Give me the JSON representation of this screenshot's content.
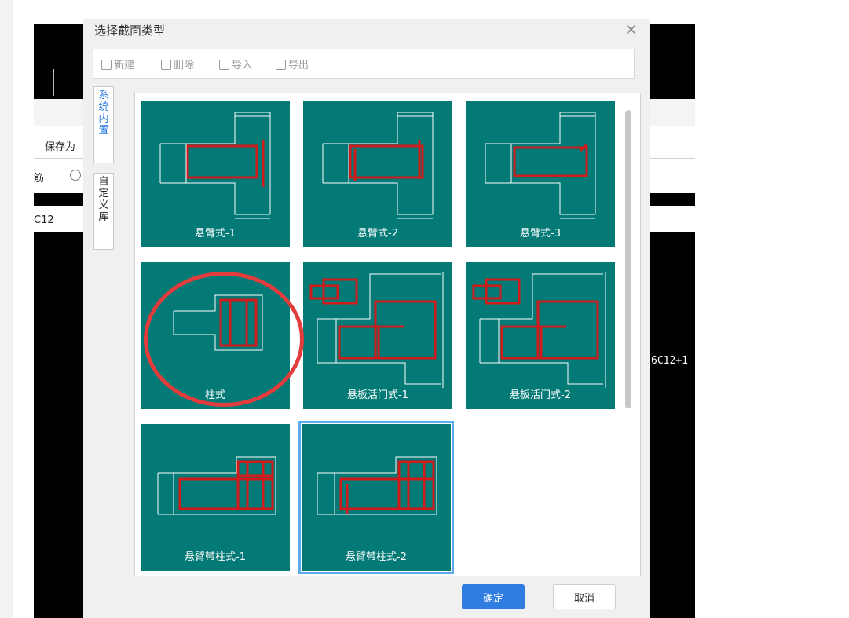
{
  "dialog": {
    "title": "选择截面类型",
    "close_symbol": "×",
    "toolbar": {
      "new_label": "新建",
      "delete_label": "删除",
      "import_label": "导入",
      "export_label": "导出"
    },
    "tabs": {
      "system": "系统内置",
      "custom": "自定义库"
    },
    "tiles": [
      "悬臂式-1",
      "悬臂式-2",
      "悬臂式-3",
      "柱式",
      "悬板活门式-1",
      "悬板活门式-2",
      "悬臂带柱式-1",
      "悬臂带柱式-2"
    ],
    "selected_tile": "悬臂带柱式-2",
    "ok_label": "确定",
    "cancel_label": "取消"
  },
  "background": {
    "save_as_label": "保存为",
    "rebar_label": "筋",
    "field_value": "C12",
    "canvas_text": "6C12+1"
  },
  "colors": {
    "tile_bg": "#047a76",
    "rebar": "#d11a1a",
    "accent": "#2f7de1",
    "selection": "#5aaef0",
    "annotation": "#e23c3c"
  }
}
